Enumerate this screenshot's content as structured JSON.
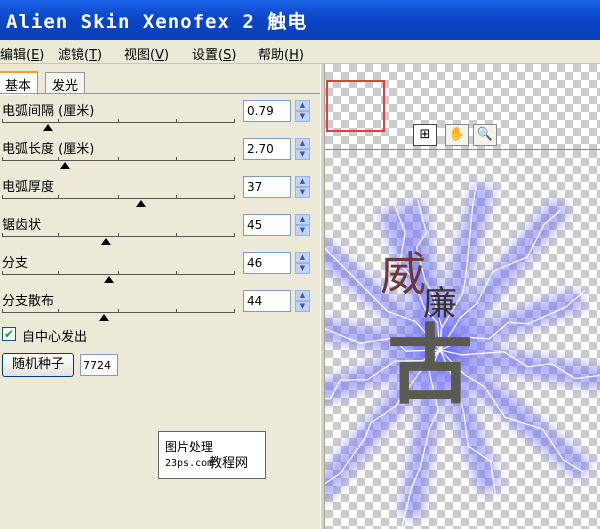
{
  "window": {
    "title": "Alien Skin Xenofex 2 触电"
  },
  "menu": [
    {
      "label": "编辑(",
      "key": "E",
      "tail": ")"
    },
    {
      "label": "滤镜(",
      "key": "T",
      "tail": ")"
    },
    {
      "label": "视图(",
      "key": "V",
      "tail": ")"
    },
    {
      "label": "设置(",
      "key": "S",
      "tail": ")"
    },
    {
      "label": "帮助(",
      "key": "H",
      "tail": ")"
    }
  ],
  "tabs": [
    {
      "label": "基本",
      "active": true
    },
    {
      "label": "发光",
      "active": false
    }
  ],
  "params": [
    {
      "label": "电弧间隔 (厘米)",
      "value": "0.79",
      "level": 0.2
    },
    {
      "label": "电弧长度 (厘米)",
      "value": "2.70",
      "level": 0.27
    },
    {
      "label": "电弧厚度",
      "value": "37",
      "level": 0.6
    },
    {
      "label": "锯齿状",
      "value": "45",
      "level": 0.45
    },
    {
      "label": "分支",
      "value": "46",
      "level": 0.46
    },
    {
      "label": "分支散布",
      "value": "44",
      "level": 0.44
    }
  ],
  "checkbox": {
    "label": "自中心发出",
    "checked": true,
    "mark": "✔"
  },
  "seed": {
    "button_label": "随机种子",
    "value": "7724"
  },
  "watermark": {
    "line1": "图片处理",
    "line2": "23ps.com",
    "line3": "教程网"
  },
  "tools": [
    {
      "name": "zoom-preview-tool",
      "glyph": "⊞"
    },
    {
      "name": "hand-tool",
      "glyph": "✋"
    },
    {
      "name": "magnifier-tool",
      "glyph": "🔍"
    }
  ],
  "preview": {
    "chars": [
      "威",
      "廉",
      "古"
    ],
    "glow_color": "#7070ff",
    "char_color": "#6a3a3a"
  }
}
